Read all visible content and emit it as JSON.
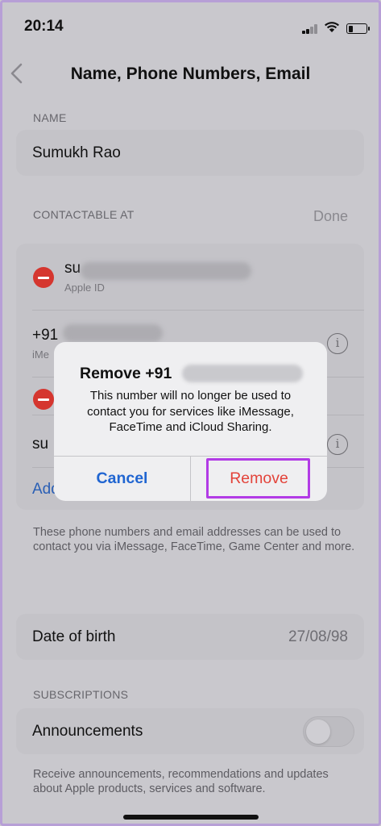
{
  "status": {
    "time": "20:14"
  },
  "nav": {
    "title": "Name, Phone Numbers, Email"
  },
  "name_section": {
    "header": "NAME",
    "value": "Sumukh Rao"
  },
  "contact_section": {
    "header": "CONTACTABLE AT",
    "done_label": "Done",
    "rows": [
      {
        "prefix": "su",
        "sub": "Apple ID"
      },
      {
        "prefix": "+91",
        "sub": "iMe"
      },
      {
        "prefix": "su"
      },
      {
        "add_label": "Add"
      }
    ]
  },
  "contact_footnote": "These phone numbers and email addresses can be used to contact you via iMessage, FaceTime, Game Center and more.",
  "birth": {
    "label": "Date of birth",
    "value": "27/08/98"
  },
  "subscriptions": {
    "header": "SUBSCRIPTIONS",
    "label": "Announcements",
    "toggle_on": false,
    "footnote": "Receive announcements, recommendations and updates about Apple products, services and software."
  },
  "alert": {
    "title": "Remove +91",
    "message": "This number will no longer be used to contact you for services like iMessage, FaceTime and iCloud Sharing.",
    "cancel_label": "Cancel",
    "remove_label": "Remove"
  },
  "colors": {
    "accent_blue": "#2065d1",
    "destructive_red": "#e3433a",
    "highlight_purple": "#b23be6"
  },
  "icons": [
    "chevron-left-icon",
    "signal-icon",
    "wifi-icon",
    "battery-icon",
    "minus-circle-icon",
    "info-icon"
  ]
}
